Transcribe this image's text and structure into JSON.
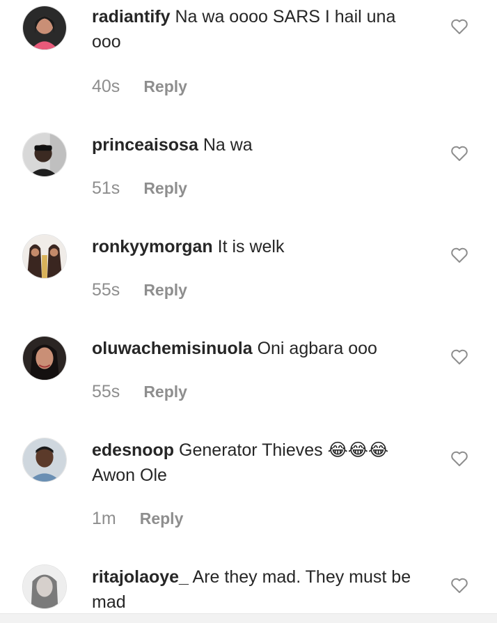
{
  "comments": [
    {
      "username": "radiantify",
      "text": "Na wa oooo SARS I hail una ooo",
      "time": "40s",
      "reply": "Reply",
      "avatar_bg": "#2a2a2a",
      "avatar_fg": "#e85a7a"
    },
    {
      "username": "princeaisosa",
      "text": "Na wa",
      "time": "51s",
      "reply": "Reply",
      "avatar_bg": "#d8d8d8",
      "avatar_fg": "#1f1f1f"
    },
    {
      "username": "ronkyymorgan",
      "text": "It is welk",
      "time": "55s",
      "reply": "Reply",
      "avatar_bg": "#f0ece8",
      "avatar_fg": "#3a2620"
    },
    {
      "username": "oluwachemisinuola",
      "text": "Oni agbara ooo",
      "time": "55s",
      "reply": "Reply",
      "avatar_bg": "#2b2523",
      "avatar_fg": "#c98f76"
    },
    {
      "username": "edesnoop",
      "text": "Generator Thieves 😂😂😂 Awon Ole",
      "time": "1m",
      "reply": "Reply",
      "avatar_bg": "#cfd7de",
      "avatar_fg": "#5b3a2a"
    },
    {
      "username": "ritajolaoye_",
      "text": "Are they mad. They must be mad",
      "time": "",
      "reply": "",
      "avatar_bg": "#eeeeee",
      "avatar_fg": "#7a7a7a"
    }
  ],
  "colors": {
    "text": "#262626",
    "muted": "#8e8e8e",
    "heart": "#8e8e8e"
  },
  "icons": {
    "like": "heart-outline-icon",
    "avatar": "user-avatar-photo"
  }
}
